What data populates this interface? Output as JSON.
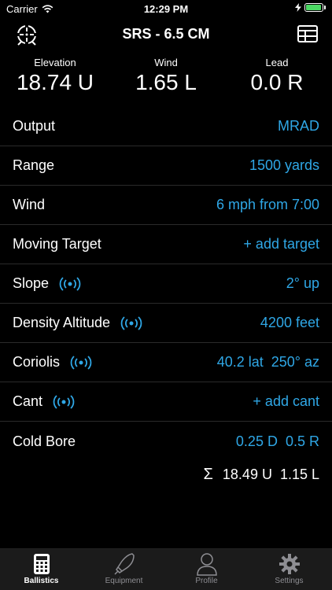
{
  "status_bar": {
    "carrier": "Carrier",
    "time": "12:29 PM"
  },
  "nav": {
    "title": "SRS - 6.5 CM",
    "left_icon": "reticle-icon",
    "right_icon": "table-icon"
  },
  "readouts": [
    {
      "label": "Elevation",
      "value": "18.74 U"
    },
    {
      "label": "Wind",
      "value": "1.65 L"
    },
    {
      "label": "Lead",
      "value": "0.0 R"
    }
  ],
  "rows": {
    "output": {
      "label": "Output",
      "value": "MRAD"
    },
    "range": {
      "label": "Range",
      "value": "1500 yards"
    },
    "wind": {
      "label": "Wind",
      "value": "6 mph from 7:00"
    },
    "moving_target": {
      "label": "Moving Target",
      "value": "+ add target"
    },
    "slope": {
      "label": "Slope",
      "value": "2° up"
    },
    "density_altitude": {
      "label": "Density Altitude",
      "value": "4200 feet"
    },
    "coriolis": {
      "label": "Coriolis",
      "value_a": "40.2 lat",
      "value_b": "250° az"
    },
    "cant": {
      "label": "Cant",
      "value": "+ add cant"
    },
    "cold_bore": {
      "label": "Cold Bore",
      "value_a": "0.25 D",
      "value_b": "0.5 R"
    }
  },
  "summary": {
    "symbol": "Σ",
    "elevation": "18.49 U",
    "wind": "1.15 L"
  },
  "tabs": [
    {
      "label": "Ballistics",
      "icon": "calculator-icon",
      "active": true
    },
    {
      "label": "Equipment",
      "icon": "bullet-icon",
      "active": false
    },
    {
      "label": "Profile",
      "icon": "person-icon",
      "active": false
    },
    {
      "label": "Settings",
      "icon": "gear-icon",
      "active": false
    }
  ],
  "colors": {
    "accent": "#2fa7e6",
    "background": "#000000",
    "tab_bar": "#1b1b1b",
    "battery": "#4cd964"
  }
}
